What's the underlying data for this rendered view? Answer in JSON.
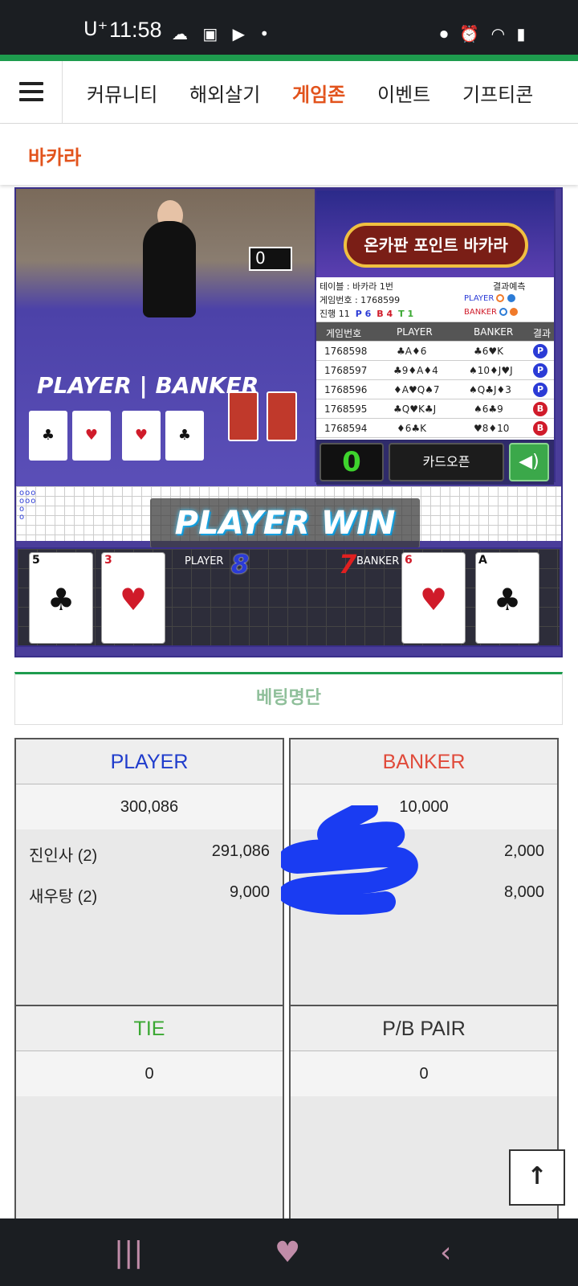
{
  "status_bar": {
    "time": "11:58",
    "carrier": "U⁺",
    "left_icons": "☁ ▣ ▶ •",
    "right_icons": "⏺ ⏰ ◠ ▮"
  },
  "nav": {
    "menu_icon": "hamburger-icon",
    "items": [
      "커뮤니티",
      "해외살기",
      "게임존",
      "이벤트",
      "기프티콘"
    ],
    "active_index": 2,
    "accent": "#e2531c"
  },
  "page_title": "바카라",
  "game": {
    "table_text": "PLAYER | BANKER",
    "shoe_counter": "0",
    "banner": "온카판 포인트 바카라",
    "info": {
      "table": "테이블 : 바카라 1번",
      "predict": "결과예측",
      "game_no": "게임번호 : 1768599",
      "progress_label": "진행 11",
      "p_count": "P 6",
      "b_count": "B 4",
      "t_count": "T 1",
      "player": "PLAYER",
      "banker": "BANKER"
    },
    "history": {
      "headers": [
        "게임번호",
        "PLAYER",
        "BANKER",
        "결과"
      ],
      "rows": [
        {
          "no": "1768598",
          "player": "♣A♦6",
          "banker": "♣6♥K",
          "result": "P"
        },
        {
          "no": "1768597",
          "player": "♣9♦A♦4",
          "banker": "♠10♦J♥J",
          "result": "P"
        },
        {
          "no": "1768596",
          "player": "♦A♥Q♠7",
          "banker": "♠Q♣J♦3",
          "result": "P"
        },
        {
          "no": "1768595",
          "player": "♣Q♥K♣J",
          "banker": "♠6♣9",
          "result": "B"
        },
        {
          "no": "1768594",
          "player": "♦6♣K",
          "banker": "♥8♦10",
          "result": "B"
        }
      ]
    },
    "timer": "0",
    "card_open": "카드오픈",
    "sound_icon": "speaker-icon",
    "result_text": "PLAYER WIN",
    "player_label": "PLAYER",
    "player_score": "8",
    "banker_label": "BANKER",
    "banker_score": "7",
    "player_cards": [
      {
        "rank": "5",
        "suit": "♣"
      },
      {
        "rank": "3",
        "suit": "♥"
      }
    ],
    "banker_cards": [
      {
        "rank": "6",
        "suit": "♥"
      },
      {
        "rank": "A",
        "suit": "♣"
      }
    ]
  },
  "bet_list_title": "베팅명단",
  "bets": {
    "player": {
      "label": "PLAYER",
      "color": "#1f3ccc",
      "total": "300,086",
      "entries": [
        {
          "name": "진인사 (2)",
          "amount": "291,086"
        },
        {
          "name": "새우탕 (2)",
          "amount": "9,000"
        }
      ]
    },
    "banker": {
      "label": "BANKER",
      "color": "#e04a3a",
      "total": "10,000",
      "entries": [
        {
          "name": "",
          "amount": "2,000"
        },
        {
          "name": "",
          "amount": "8,000"
        }
      ]
    },
    "tie": {
      "label": "TIE",
      "color": "#3aa832",
      "total": "0"
    },
    "pair": {
      "label": "P/B PAIR",
      "color": "#333333",
      "total": "0"
    }
  },
  "scroll_top_icon": "arrow-up-icon",
  "bottom_nav": [
    "recents-icon",
    "heart-icon",
    "back-icon"
  ]
}
